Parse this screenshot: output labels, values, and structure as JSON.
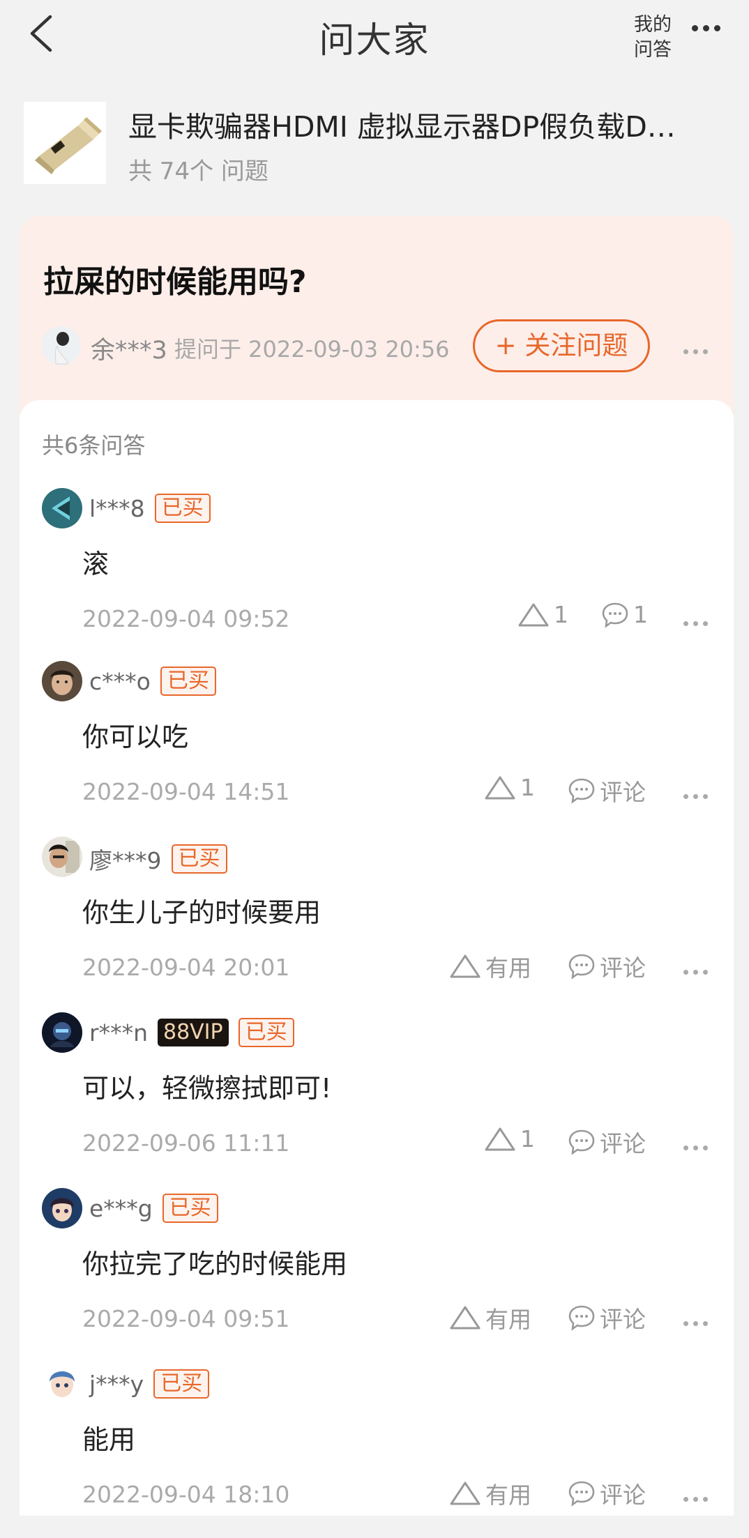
{
  "header": {
    "title": "问大家",
    "my_qa_line1": "我的",
    "my_qa_line2": "问答"
  },
  "product": {
    "title": "显卡欺骗器HDMI 虚拟显示器DP假负载D…",
    "question_count": "共 74个 问题"
  },
  "question": {
    "title": "拉屎的时候能用吗?",
    "asker": "余***3",
    "asked_at": "提问于 2022-09-03 20:56",
    "follow_label": "+ 关注问题"
  },
  "answers_header": "共6条问答",
  "answers": [
    {
      "user": "l***8",
      "vip": "",
      "badge": "已买",
      "text": "滚",
      "time": "2022-09-04 09:52",
      "like": "1",
      "comment": "1"
    },
    {
      "user": "c***o",
      "vip": "",
      "badge": "已买",
      "text": "你可以吃",
      "time": "2022-09-04 14:51",
      "like": "1",
      "comment": "评论"
    },
    {
      "user": "廖***9",
      "vip": "",
      "badge": "已买",
      "text": "你生儿子的时候要用",
      "time": "2022-09-04 20:01",
      "like": "有用",
      "comment": "评论"
    },
    {
      "user": "r***n",
      "vip": "88VIP",
      "badge": "已买",
      "text": "可以，轻微擦拭即可!",
      "time": "2022-09-06 11:11",
      "like": "1",
      "comment": "评论"
    },
    {
      "user": "e***g",
      "vip": "",
      "badge": "已买",
      "text": "你拉完了吃的时候能用",
      "time": "2022-09-04 09:51",
      "like": "有用",
      "comment": "评论"
    },
    {
      "user": "j***y",
      "vip": "",
      "badge": "已买",
      "text": "能用",
      "time": "2022-09-04 18:10",
      "like": "有用",
      "comment": "评论"
    }
  ],
  "colors": {
    "accent": "#e8672a",
    "card_bg": "#fdeee9",
    "page_bg": "#f2f2f2"
  }
}
